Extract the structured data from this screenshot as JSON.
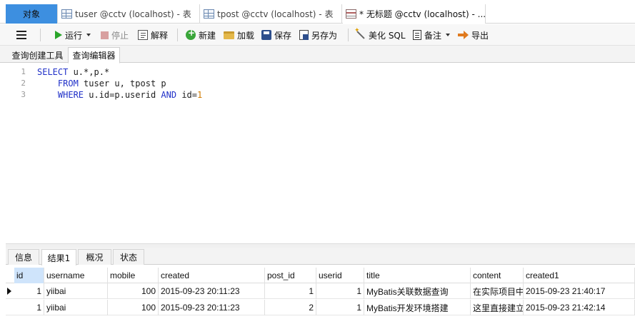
{
  "doc_tabs": {
    "objects": "对象",
    "tab1": "tuser @cctv (localhost) - 表",
    "tab2": "tpost @cctv (localhost) - 表",
    "tab3": "* 无标题 @cctv (localhost) - ..."
  },
  "toolbar": {
    "run": "运行",
    "stop": "停止",
    "explain": "解释",
    "new": "新建",
    "load": "加载",
    "save": "保存",
    "save_as": "另存为",
    "beautify": "美化 SQL",
    "note": "备注",
    "export": "导出"
  },
  "editor_tabs": {
    "builder": "查询创建工具",
    "editor": "查询编辑器"
  },
  "code": {
    "line_numbers": [
      "1",
      "2",
      "3"
    ],
    "line1": {
      "kw1": "SELECT",
      "rest": " u.*,p.*"
    },
    "line2": {
      "indent": "    ",
      "kw1": "FROM",
      "rest": " tuser u, tpost p"
    },
    "line3": {
      "indent": "    ",
      "kw1": "WHERE",
      "mid": " u.id=p.userid ",
      "kw2": "AND",
      "rest2": " id=",
      "num": "1"
    }
  },
  "result_tabs": {
    "info": "信息",
    "result1": "结果1",
    "overview": "概况",
    "status": "状态"
  },
  "grid": {
    "columns": [
      "id",
      "username",
      "mobile",
      "created",
      "post_id",
      "userid",
      "title",
      "content",
      "created1"
    ],
    "rows": [
      [
        "1",
        "yiibai",
        "100",
        "2015-09-23 20:11:23",
        "1",
        "1",
        "MyBatis关联数据查询",
        "在实际项目中",
        "2015-09-23 21:40:17"
      ],
      [
        "1",
        "yiibai",
        "100",
        "2015-09-23 20:11:23",
        "2",
        "1",
        "MyBatis开发环境搭建",
        "这里直接建立",
        "2015-09-23 21:42:14"
      ]
    ]
  }
}
